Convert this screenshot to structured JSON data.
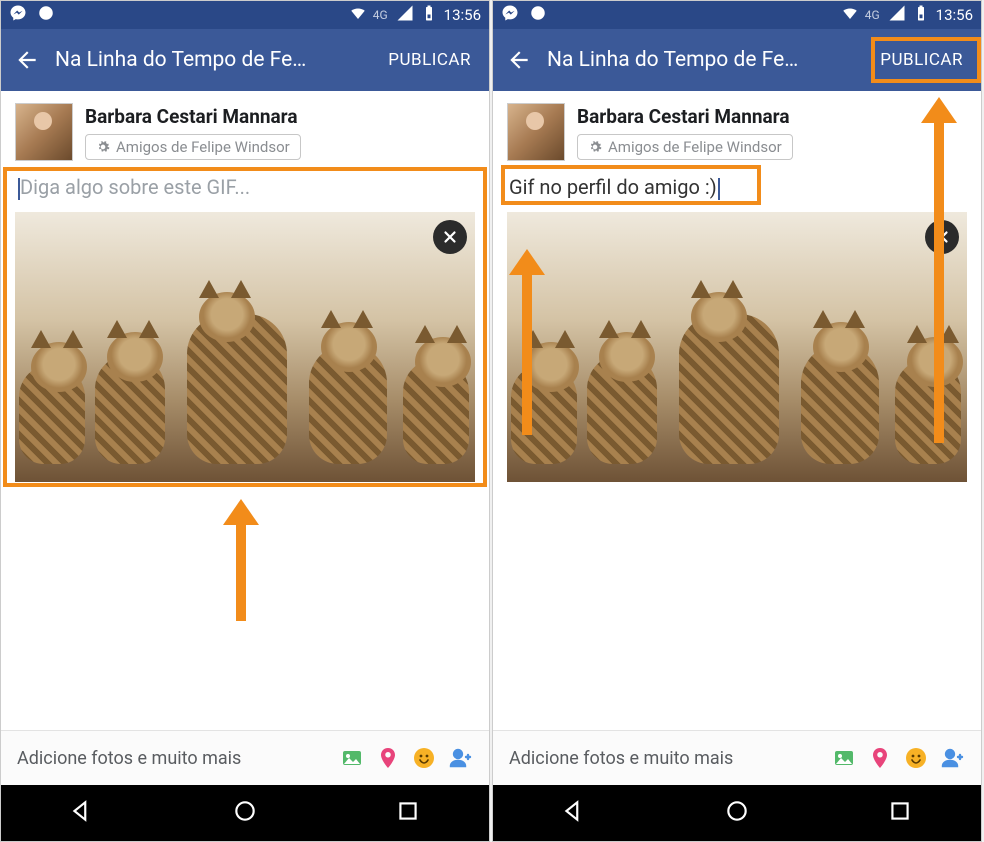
{
  "statusbar": {
    "network_label": "4G",
    "time": "13:56"
  },
  "appbar": {
    "title": "Na Linha do Tempo de Fe…",
    "publish_label": "PUBLICAR"
  },
  "author": {
    "name": "Barbara Cestari Mannara",
    "audience": "Amigos de Felipe Windsor"
  },
  "compose_left": {
    "placeholder": "Diga algo sobre este GIF..."
  },
  "compose_right": {
    "text": "Gif no perfil do amigo :)"
  },
  "attach": {
    "label": "Adicione fotos e muito mais"
  },
  "icons": {
    "photo_color": "#53b96a",
    "location_color": "#e8447b",
    "emoji_color": "#f7b125",
    "tag_person_color": "#4a90e2"
  }
}
